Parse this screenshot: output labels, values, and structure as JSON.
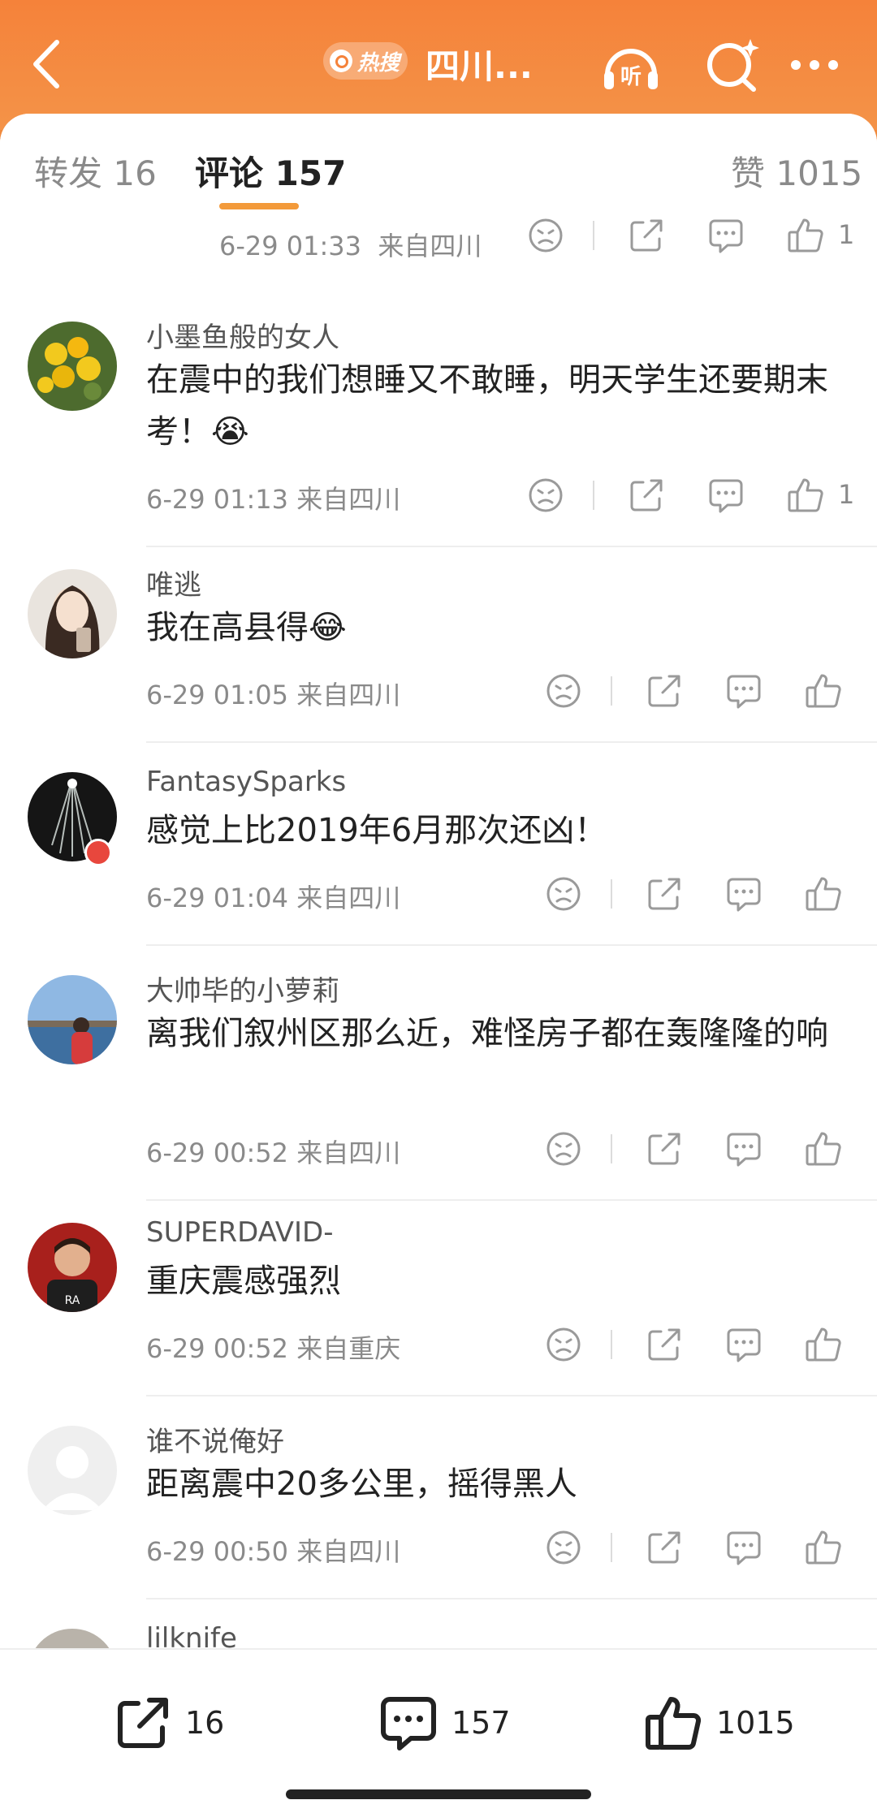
{
  "header": {
    "hot_label": "热搜",
    "title": "四川...",
    "icons": [
      "back-icon",
      "listen-icon",
      "search-sparkle-icon",
      "more-icon"
    ],
    "listen_label": "听"
  },
  "tabs": {
    "repost": "转发 16",
    "comment": "评论 157",
    "like": "赞 1015"
  },
  "partial_top": {
    "time": "6-29 01:33",
    "location": "来自四川",
    "likes": "1"
  },
  "comments": [
    {
      "user": "小墨鱼般的女人",
      "text": "在震中的我们想睡又不敢睡，明天学生还要期末考！😭",
      "time": "6-29 01:13",
      "location": "来自四川",
      "likes": "1"
    },
    {
      "user": "唯逃",
      "text": "我在高县得😂",
      "time": "6-29 01:05",
      "location": "来自四川",
      "likes": ""
    },
    {
      "user": "FantasySparks",
      "text": "感觉上比2019年6月那次还凶！",
      "time": "6-29 01:04",
      "location": "来自四川",
      "likes": ""
    },
    {
      "user": "大帅毕的小萝莉",
      "text": "离我们叙州区那么近，难怪房子都在轰隆隆的响",
      "time": "6-29 00:52",
      "location": "来自四川",
      "likes": ""
    },
    {
      "user": "SUPERDAVID-",
      "text": "重庆震感强烈",
      "time": "6-29 00:52",
      "location": "来自重庆",
      "likes": ""
    },
    {
      "user": "谁不说俺好",
      "text": "距离震中20多公里，摇得黑人",
      "time": "6-29 00:50",
      "location": "来自四川",
      "likes": ""
    },
    {
      "user": "lilknife_",
      "text": "",
      "time": "",
      "location": "",
      "likes": ""
    }
  ],
  "bottom_bar": {
    "repost_count": "16",
    "comment_count": "157",
    "like_count": "1015"
  },
  "colors": {
    "accent": "#f5823a",
    "tab_underline": "#f39a3a",
    "text": "#222222",
    "meta": "#8a8a8a"
  }
}
